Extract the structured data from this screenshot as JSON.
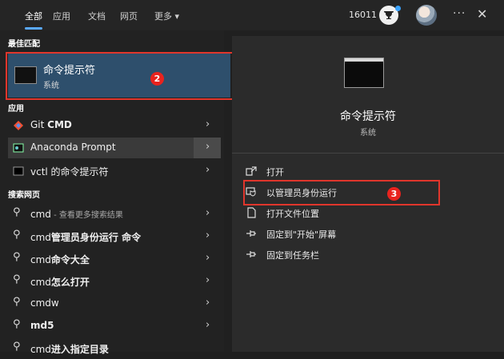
{
  "tabs": [
    "全部",
    "应用",
    "文档",
    "网页",
    "更多 ▾"
  ],
  "points": "16011",
  "left": {
    "best_match_header": "最佳匹配",
    "best_match": {
      "title": "命令提示符",
      "subtitle": "系统",
      "step_badge": "2"
    },
    "apps_header": "应用",
    "apps": [
      {
        "label": "Git ",
        "bold": "CMD"
      },
      {
        "label": "Anaconda Prompt",
        "bold": ""
      },
      {
        "label": "vctl 的命令提示符",
        "bold": ""
      }
    ],
    "web_header": "搜索网页",
    "web_results": [
      {
        "pre": "cmd",
        "bold": "",
        "sub": " - 查看更多搜索结果"
      },
      {
        "pre": "cmd",
        "bold": "管理员身份运行 命令",
        "sub": ""
      },
      {
        "pre": "cmd",
        "bold": "命令大全",
        "sub": ""
      },
      {
        "pre": "cmd",
        "bold": "怎么打开",
        "sub": ""
      },
      {
        "pre": "cmd",
        "bold": "w",
        "sub": ""
      },
      {
        "pre": "",
        "bold": "md5",
        "sub": ""
      },
      {
        "pre": "cmd",
        "bold": "进入指定目录",
        "sub": ""
      }
    ]
  },
  "right": {
    "title": "命令提示符",
    "subtitle": "系统",
    "actions": [
      "打开",
      "以管理员身份运行",
      "打开文件位置",
      "固定到\"开始\"屏幕",
      "固定到任务栏"
    ],
    "step_badge": "3"
  },
  "colors": {
    "highlight": "#2e4f6c",
    "callout": "#e0362c",
    "accent": "#5aa9ff"
  }
}
